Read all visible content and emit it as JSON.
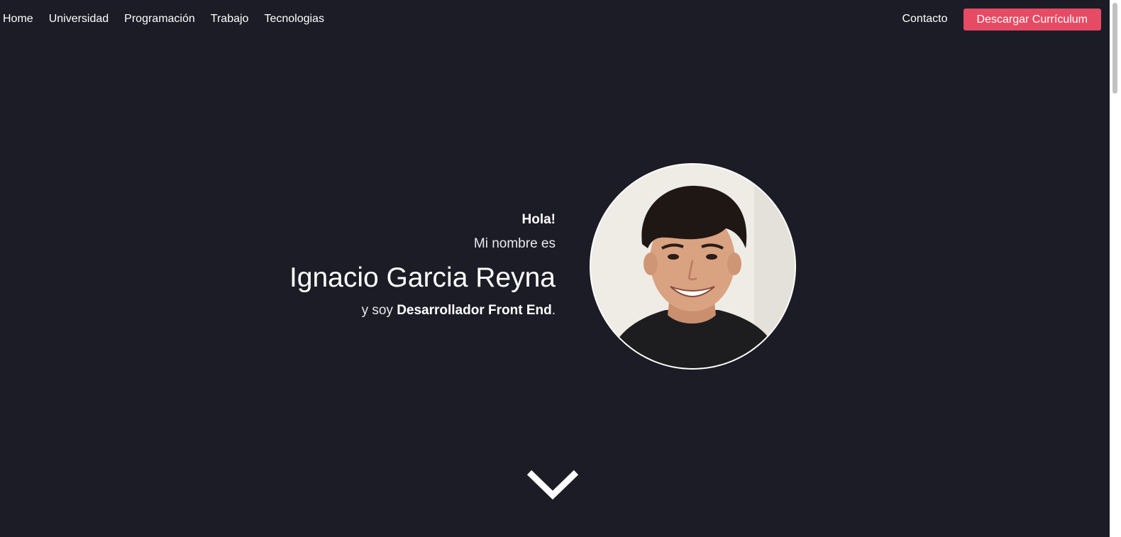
{
  "nav": {
    "left_items": [
      {
        "label": "Home"
      },
      {
        "label": "Universidad"
      },
      {
        "label": "Programación"
      },
      {
        "label": "Trabajo"
      },
      {
        "label": "Tecnologias"
      }
    ],
    "contact_label": "Contacto",
    "cv_button_label": "Descargar Currículum"
  },
  "hero": {
    "greeting": "Hola!",
    "intro": "Mi nombre es",
    "name": "Ignacio Garcia Reyna",
    "role_prefix": "y soy ",
    "role": "Desarrollador Front End",
    "role_suffix": "."
  },
  "icons": {
    "scroll_down": "chevron-down-icon",
    "avatar": "profile-photo"
  },
  "colors": {
    "background": "#1c1c26",
    "accent": "#e64a64",
    "text": "#ffffff"
  }
}
